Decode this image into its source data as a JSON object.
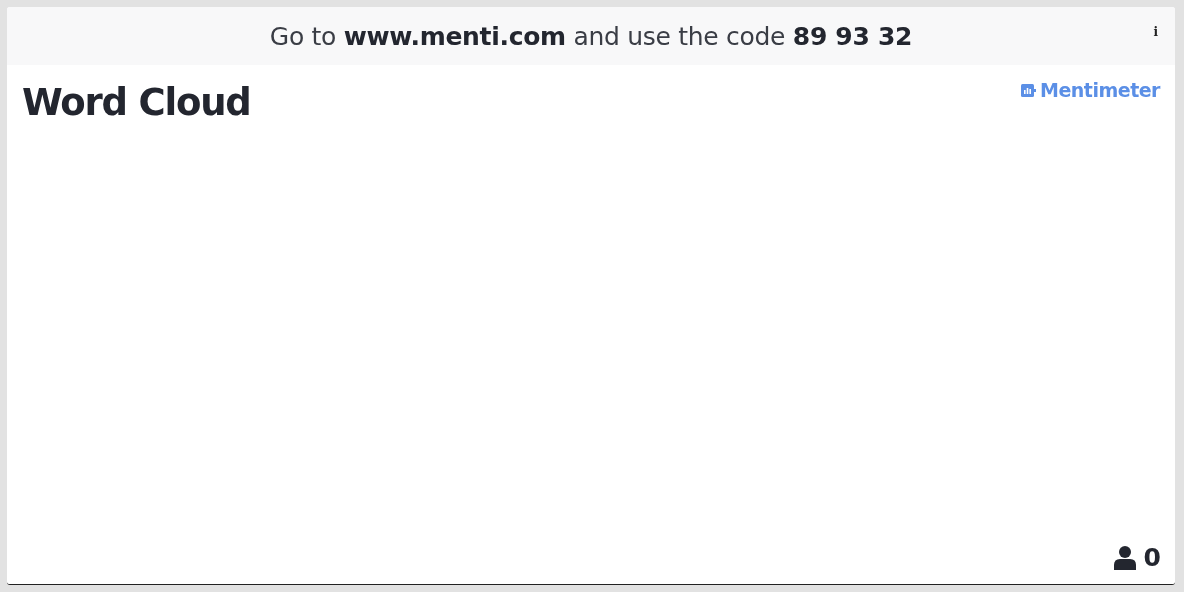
{
  "header": {
    "instruction": "Go to **www.menti.com** and use the code **89 93 32**",
    "info": "i"
  },
  "slide": {
    "title": "Word Cloud",
    "brand": "Mentimeter"
  },
  "footer": {
    "participants": "0"
  }
}
